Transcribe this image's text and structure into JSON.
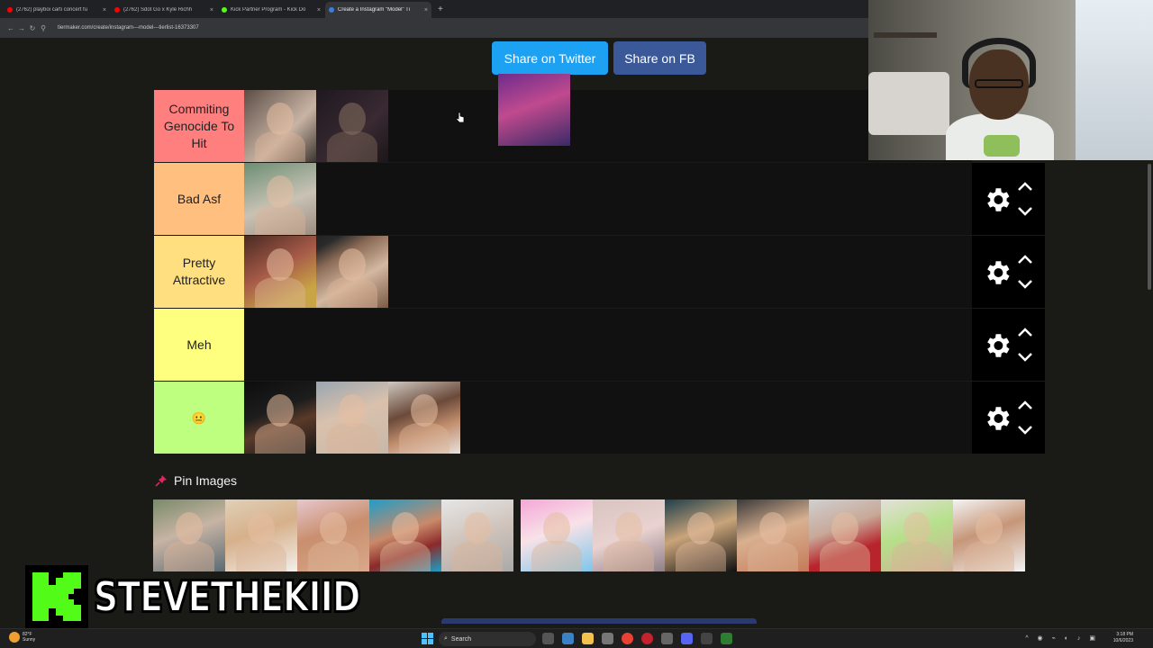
{
  "browser": {
    "tabs": [
      {
        "title": "(2762) playboi carti concert fu",
        "active": false,
        "icon_color": "#ff0000"
      },
      {
        "title": "(2762) Sdot Go x Kyle Richh",
        "active": false,
        "icon_color": "#ff0000"
      },
      {
        "title": "Kick Partner Program - Kick Do",
        "active": false,
        "icon_color": "#53fc18"
      },
      {
        "title": "Create a Instagram \"Model\" Ti",
        "active": true,
        "icon_color": "#3b7ddd"
      }
    ],
    "new_tab": "+",
    "tab_close": "×",
    "url": "tiermaker.com/create/instagram---model---tierlist-16373307"
  },
  "share": {
    "twitter_label": "Share on Twitter",
    "facebook_label": "Share on FB"
  },
  "tiers": [
    {
      "label": "Commiting Genocide To Hit",
      "color": "#ff7f7f",
      "items": 2
    },
    {
      "label": "Bad Asf",
      "color": "#ffbf7f",
      "items": 1
    },
    {
      "label": "Pretty Attractive",
      "color": "#ffdf7f",
      "items": 2
    },
    {
      "label": "Meh",
      "color": "#ffff7f",
      "items": 0
    },
    {
      "label": "😐",
      "color": "#bfff7f",
      "items": 3
    }
  ],
  "pin_images": {
    "label": "Pin Images",
    "count": 12
  },
  "streamer": {
    "name": "STEVETHEKIID",
    "brand_color": "#53fc18"
  },
  "taskbar": {
    "weather_temp": "82°F",
    "weather_desc": "Sunny",
    "search_label": "Search",
    "time": "3:18 PM",
    "date": "10/6/2023"
  }
}
